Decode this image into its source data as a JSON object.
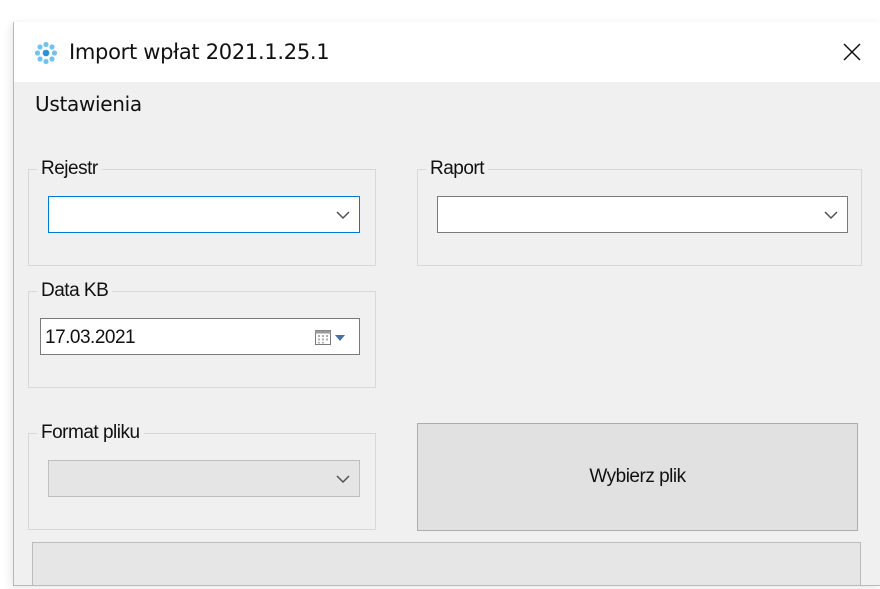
{
  "window": {
    "title": "Import wpłat 2021.1.25.1",
    "close_glyph": "✕"
  },
  "menu": {
    "items": [
      {
        "label": "Ustawienia"
      }
    ]
  },
  "groups": {
    "rejestr": {
      "label": "Rejestr",
      "selected": ""
    },
    "raport": {
      "label": "Raport",
      "selected": ""
    },
    "data_kb": {
      "label": "Data KB",
      "value": "17.03.2021"
    },
    "format_pliku": {
      "label": "Format pliku",
      "selected": ""
    }
  },
  "buttons": {
    "wybierz_plik": "Wybierz plik"
  },
  "progress": {
    "value": 0
  },
  "icons": {
    "app": "app-icon",
    "close": "close-icon",
    "chevron": "chevron-down-icon",
    "calendar": "calendar-icon"
  },
  "colors": {
    "accent": "#0078d7",
    "window_bg": "#f0f0f0",
    "titlebar_bg": "#ffffff"
  }
}
